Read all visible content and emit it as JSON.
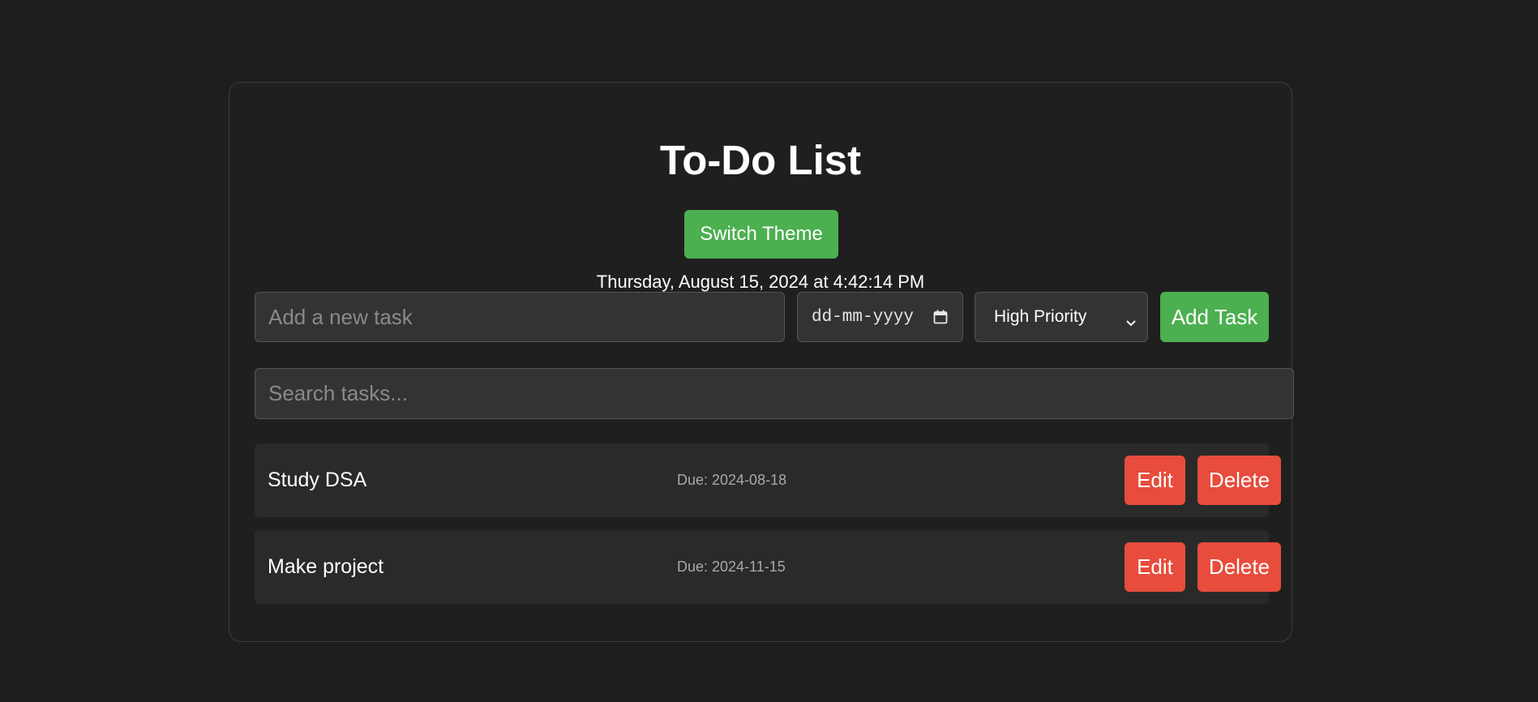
{
  "app": {
    "title": "To-Do List",
    "theme_button": "Switch Theme",
    "datetime": "Thursday, August 15, 2024 at 4:42:14 PM"
  },
  "form": {
    "task_placeholder": "Add a new task",
    "task_value": "",
    "date_placeholder": "dd-mm-yyyy",
    "priority_selected": "High Priority",
    "add_button": "Add Task"
  },
  "search": {
    "placeholder": "Search tasks...",
    "value": ""
  },
  "tasks": [
    {
      "name": "Study DSA",
      "due": "Due: 2024-08-18",
      "edit_label": "Edit",
      "delete_label": "Delete"
    },
    {
      "name": "Make project",
      "due": "Due: 2024-11-15",
      "edit_label": "Edit",
      "delete_label": "Delete"
    }
  ],
  "icons": {
    "date": "calendar-icon",
    "select": "chevron-down-icon"
  },
  "colors": {
    "background": "#1e1e1e",
    "accent": "#4caf50",
    "danger": "#e74c3c",
    "input_bg": "#333333",
    "row_bg": "#2a2a2a"
  }
}
